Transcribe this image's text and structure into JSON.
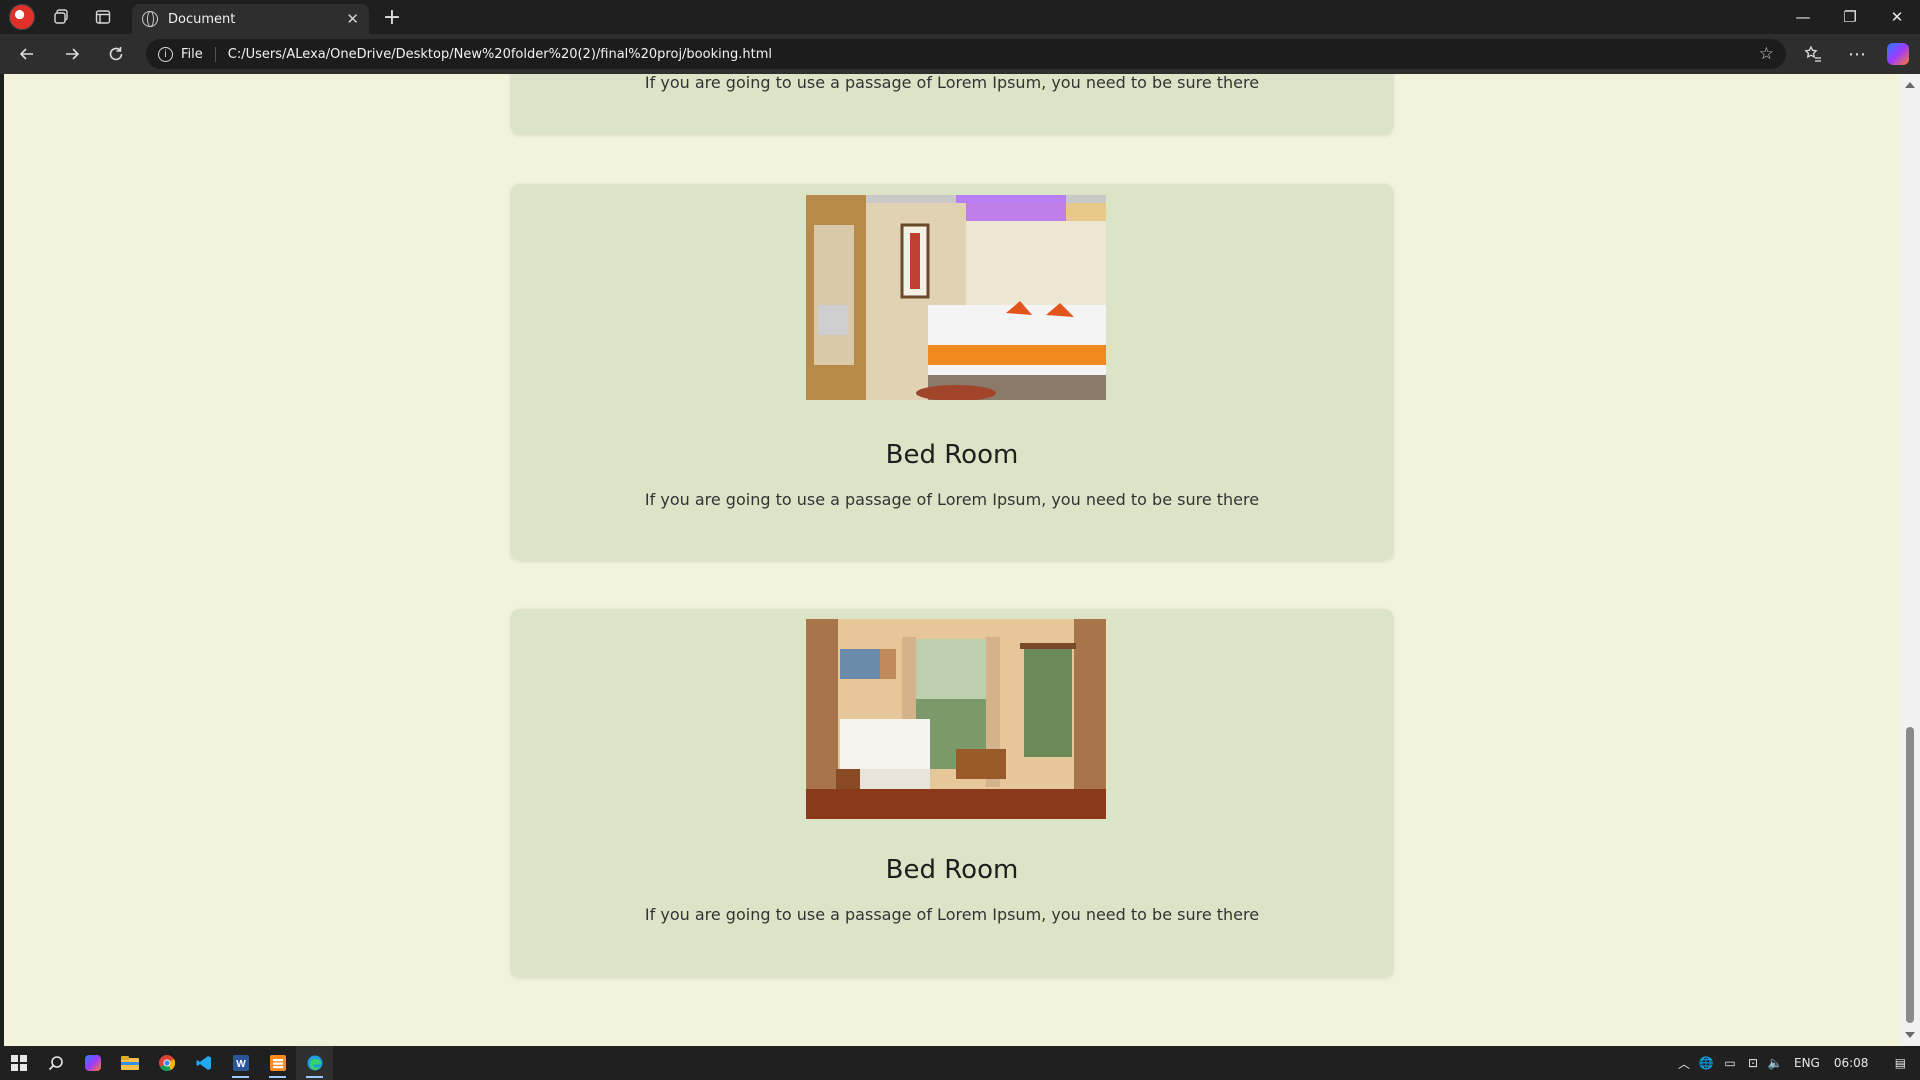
{
  "browser": {
    "tab_title": "Document",
    "tab_close": "✕",
    "new_tab": "+",
    "address_scheme": "File",
    "url": "C:/Users/ALexa/OneDrive/Desktop/New%20folder%20(2)/final%20proj/booking.html",
    "window_controls": {
      "minimize": "—",
      "restore": "❐",
      "close": "✕"
    }
  },
  "page": {
    "cards": [
      {
        "title": "",
        "text": "If you are going to use a passage of Lorem Ipsum, you need to be sure there"
      },
      {
        "title": "Bed Room",
        "text": "If you are going to use a passage of Lorem Ipsum, you need to be sure there"
      },
      {
        "title": "Bed Room",
        "text": "If you are going to use a passage of Lorem Ipsum, you need to be sure there"
      }
    ]
  },
  "taskbar": {
    "language": "ENG",
    "time": "06:08"
  },
  "icons": [
    "profile-icon",
    "workspaces-icon",
    "tab-actions-icon",
    "globe-icon",
    "back-icon",
    "forward-icon",
    "refresh-icon",
    "info-icon",
    "favorite-star-icon",
    "favorites-icon",
    "more-icon",
    "copilot-icon",
    "windows-start-icon",
    "search-icon",
    "copilot-app-icon",
    "file-explorer-icon",
    "chrome-icon",
    "vscode-icon",
    "word-icon",
    "sublime-icon",
    "edge-icon",
    "chevron-up-icon",
    "network-icon",
    "battery-icon",
    "wifi-icon",
    "volume-icon",
    "notification-icon"
  ],
  "colors": {
    "page_background": "#f3f3dc",
    "card_background": "#dce4c8",
    "chrome_dark": "#1f1f1f",
    "toolbar": "#2e2e2e"
  }
}
